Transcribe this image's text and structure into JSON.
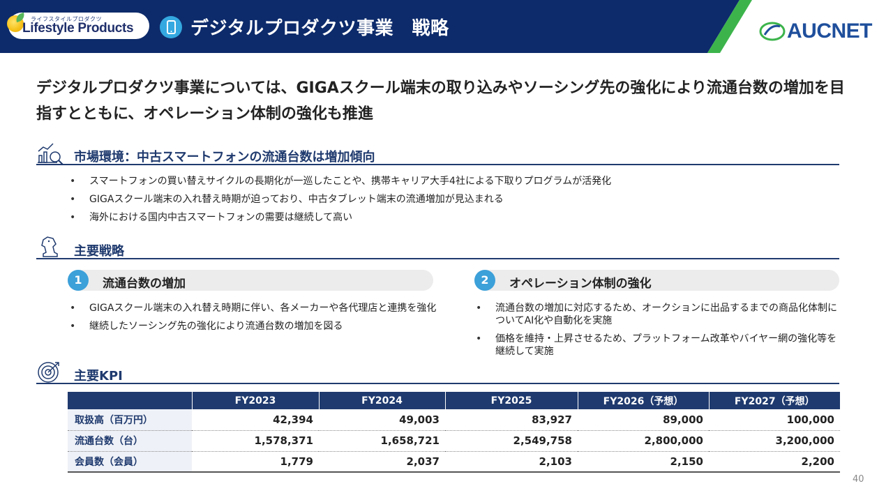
{
  "header": {
    "logo_small": "ライフスタイルプロダクツ",
    "logo_big": "Lifestyle Products",
    "title": "デジタルプロダクツ事業　戦略",
    "brand": "AUCNET"
  },
  "lead": "デジタルプロダクツ事業については、GIGAスクール端末の取り込みやソーシング先の強化により流通台数の増加を目指すとともに、オペレーション体制の強化も推進",
  "market": {
    "title": "市場環境：中古スマートフォンの流通台数は増加傾向",
    "bullets": [
      "スマートフォンの買い替えサイクルの長期化が一巡したことや、携帯キャリア大手4社による下取りプログラムが活発化",
      "GIGAスクール端末の入れ替え時期が迫っており、中古タブレット端末の流通増加が見込まれる",
      "海外における国内中古スマートフォンの需要は継続して高い"
    ]
  },
  "strategy": {
    "title": "主要戦略",
    "items": [
      {
        "num": "1",
        "label": "流通台数の増加",
        "bullets": [
          "GIGAスクール端末の入れ替え時期に伴い、各メーカーや各代理店と連携を強化",
          "継続したソーシング先の強化により流通台数の増加を図る"
        ]
      },
      {
        "num": "2",
        "label": "オペレーション体制の強化",
        "bullets": [
          "流通台数の増加に対応するため、オークションに出品するまでの商品化体制についてAI化や自動化を実施",
          "価格を維持・上昇させるため、プラットフォーム改革やバイヤー網の強化等を継続して実施"
        ]
      }
    ]
  },
  "kpi": {
    "title": "主要KPI",
    "columns": [
      "",
      "FY2023",
      "FY2024",
      "FY2025",
      "FY2026（予想）",
      "FY2027（予想）"
    ],
    "rows": [
      {
        "label": "取扱高（百万円）",
        "values": [
          "42,394",
          "49,003",
          "83,927",
          "89,000",
          "100,000"
        ]
      },
      {
        "label": "流通台数（台）",
        "values": [
          "1,578,371",
          "1,658,721",
          "2,549,758",
          "2,800,000",
          "3,200,000"
        ]
      },
      {
        "label": "会員数（会員）",
        "values": [
          "1,779",
          "2,037",
          "2,103",
          "2,150",
          "2,200"
        ]
      }
    ]
  },
  "page_number": "40",
  "colors": {
    "header_navy": "#0d2b6b",
    "accent_green": "#3cb44b",
    "accent_blue": "#3ca0d9",
    "section_navy": "#1f3a6e"
  },
  "icons": [
    "smartphone-icon",
    "aucnet-logo-icon",
    "market-chart-icon",
    "chess-knight-icon",
    "target-icon"
  ]
}
